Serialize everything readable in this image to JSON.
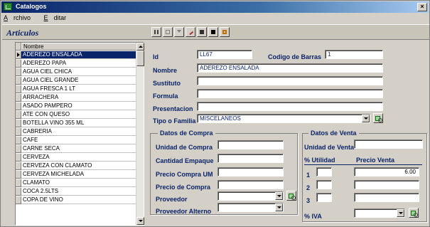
{
  "window": {
    "title": "Catalogos",
    "close_glyph": "×"
  },
  "menu": {
    "items": [
      {
        "accel": "A",
        "rest": "rchivo"
      },
      {
        "accel": "E",
        "rest": "ditar"
      }
    ]
  },
  "section": {
    "title": "Articulos"
  },
  "toolbar": {
    "buttons": [
      {
        "icon": "first-record-icon",
        "color": "#404040"
      },
      {
        "icon": "save-icon",
        "color": "#7f7f7f"
      },
      {
        "icon": "filter-icon",
        "color": "#7f7f7f"
      },
      {
        "icon": "edit-icon",
        "color": "#b03030"
      },
      {
        "icon": "calculator-icon",
        "color": "#303030"
      },
      {
        "icon": "binoculars-icon",
        "color": "#000000"
      },
      {
        "icon": "exit-icon",
        "color": "#c07000"
      }
    ]
  },
  "list": {
    "header": "Nombre",
    "rows": [
      "ADEREZO ENSALADA",
      "ADEREZO PAPA",
      "AGUA CIEL CHICA",
      "AGUA CIEL GRANDE",
      "AGUA FRESCA 1 LT",
      "ARRACHERA",
      "ASADO PAMPERO",
      "ATE CON QUESO",
      "BOTELLA VINO 355 ML",
      "CABRERIA",
      "CAFE",
      "CARNE SECA",
      "CERVEZA",
      "CERVEZA CON CLAMATO",
      "CERVEZA MICHELADA",
      "CLAMATO",
      "COCA 2.5LTS",
      "COPA DE VINO"
    ],
    "selected_index": 0
  },
  "form": {
    "id_label": "Id",
    "id_value": "LL67",
    "barcode_label": "Codigo de Barras",
    "barcode_value": "1",
    "nombre_label": "Nombre",
    "nombre_value": "ADEREZO ENSALADA",
    "sustituto_label": "Sustituto",
    "sustituto_value": "",
    "formula_label": "Formula",
    "formula_value": "",
    "presentacion_label": "Presentacion",
    "presentacion_value": "",
    "tipo_label": "Tipo o Familia",
    "tipo_value": "MISCELANEOS"
  },
  "compra": {
    "title": "Datos de Compra",
    "unidad_label": "Unidad de Compra",
    "unidad_value": "",
    "cantidad_label": "Cantidad Empaque",
    "cantidad_value": "",
    "precio_um_label": "Precio Compra UM",
    "precio_um_value": "",
    "precio_label": "Precio de Compra",
    "precio_value": "",
    "proveedor_label": "Proveedor",
    "proveedor_value": "",
    "proveedor_alt_label": "Proveedor Alterno",
    "proveedor_alt_value": ""
  },
  "venta": {
    "title": "Datos de Venta",
    "unidad_label": "Unidad de Venta",
    "unidad_value": "",
    "utilidad_header": "% Utilidad",
    "precio_header": "Precio Venta",
    "rows": [
      {
        "num": "1",
        "utilidad": "",
        "precio": "6.00"
      },
      {
        "num": "2",
        "utilidad": "",
        "precio": ""
      },
      {
        "num": "3",
        "utilidad": "",
        "precio": ""
      }
    ],
    "iva_label": "% IVA",
    "iva_value": ""
  }
}
